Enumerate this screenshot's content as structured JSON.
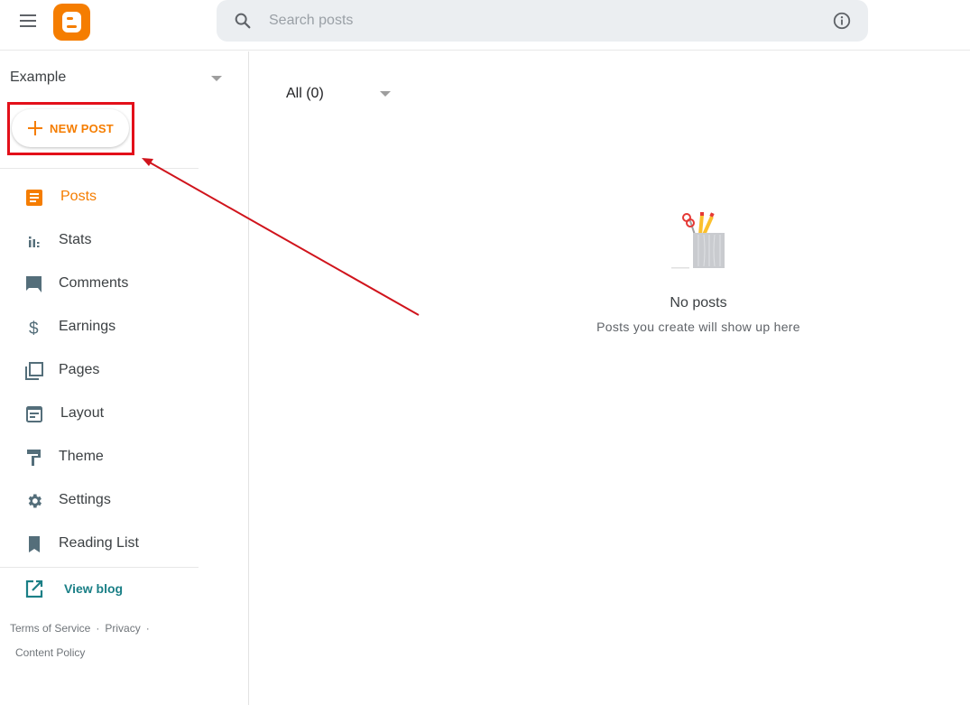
{
  "header": {
    "menu_icon": "hamburger-menu-icon",
    "logo_icon": "blogger-logo",
    "search": {
      "placeholder": "Search posts",
      "value": ""
    },
    "info_icon": "info-icon"
  },
  "sidebar": {
    "blog_name": "Example",
    "new_post_label": "NEW POST",
    "items": [
      {
        "label": "Posts",
        "icon": "posts-icon",
        "active": true
      },
      {
        "label": "Stats",
        "icon": "stats-icon"
      },
      {
        "label": "Comments",
        "icon": "comments-icon"
      },
      {
        "label": "Earnings",
        "icon": "dollar-icon"
      },
      {
        "label": "Pages",
        "icon": "pages-icon"
      },
      {
        "label": "Layout",
        "icon": "layout-icon"
      },
      {
        "label": "Theme",
        "icon": "paint-roller-icon"
      },
      {
        "label": "Settings",
        "icon": "gear-icon"
      },
      {
        "label": "Reading List",
        "icon": "bookmark-icon"
      }
    ],
    "view_blog_label": "View blog",
    "footer": {
      "terms": "Terms of Service",
      "privacy": "Privacy",
      "content_policy": "Content Policy",
      "separator": "·"
    }
  },
  "main": {
    "filter_label": "All (0)",
    "empty_title": "No posts",
    "empty_subtitle": "Posts you create will show up here"
  },
  "colors": {
    "accent": "#f57d00",
    "link": "#1a7f86",
    "annotation": "#e3101a",
    "icon": "#546e7a"
  }
}
